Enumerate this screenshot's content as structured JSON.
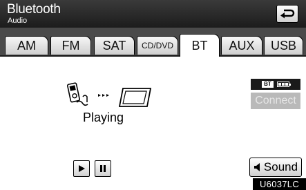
{
  "header": {
    "title": "Bluetooth",
    "subtitle": "Audio",
    "back_icon": "return-arrow-icon"
  },
  "tabs": [
    {
      "label": "AM",
      "active": false
    },
    {
      "label": "FM",
      "active": false
    },
    {
      "label": "SAT",
      "active": false
    },
    {
      "label": "CD/DVD",
      "active": false
    },
    {
      "label": "BT",
      "active": true
    },
    {
      "label": "AUX",
      "active": false
    },
    {
      "label": "USB",
      "active": false
    }
  ],
  "status": {
    "bt_badge": "BT",
    "battery_icon": "battery-icon"
  },
  "connect_label": "Connect",
  "playing_label": "Playing",
  "controls": {
    "play_icon": "play-icon",
    "pause_icon": "pause-icon"
  },
  "sound_label": "Sound",
  "code_label": "U6037LC",
  "colors": {
    "header_bg": "#2a2a2a",
    "tabbar_bg": "#4a4a4a",
    "connect_disabled": "#b9b9b9"
  }
}
